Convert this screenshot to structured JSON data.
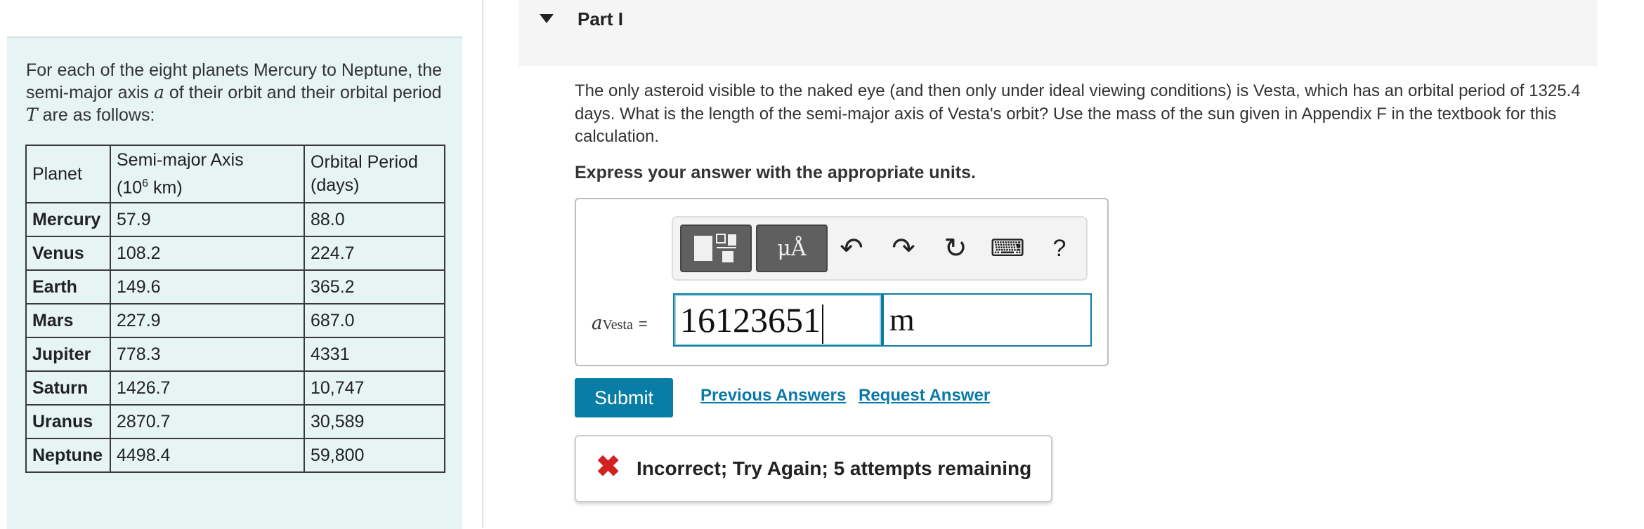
{
  "problem": {
    "intro_prefix": "For each of the eight planets Mercury to Neptune, the semi-major axis ",
    "var_a": "a",
    "intro_mid": " of their orbit and their orbital period ",
    "var_T": "T",
    "intro_suffix": " are as follows:"
  },
  "table": {
    "headers": {
      "planet": "Planet",
      "axis_line1": "Semi-major Axis",
      "axis_unit_open": "(10",
      "axis_unit_exp": "6",
      "axis_unit_close": " km)",
      "period_line1": "Orbital Period",
      "period_line2": "(days)"
    },
    "rows": [
      {
        "planet": "Mercury",
        "axis": "57.9",
        "period": "88.0"
      },
      {
        "planet": "Venus",
        "axis": "108.2",
        "period": "224.7"
      },
      {
        "planet": "Earth",
        "axis": "149.6",
        "period": "365.2"
      },
      {
        "planet": "Mars",
        "axis": "227.9",
        "period": "687.0"
      },
      {
        "planet": "Jupiter",
        "axis": "778.3",
        "period": "4331"
      },
      {
        "planet": "Saturn",
        "axis": "1426.7",
        "period": "10,747"
      },
      {
        "planet": "Uranus",
        "axis": "2870.7",
        "period": "30,589"
      },
      {
        "planet": "Neptune",
        "axis": "4498.4",
        "period": "59,800"
      }
    ]
  },
  "part": {
    "title": "Part I",
    "question": "The only asteroid visible to the naked eye (and then only under ideal viewing conditions) is Vesta, which has an orbital period of 1325.4 days. What is the length of the semi-major axis of Vesta's orbit? Use the mass of the sun given in Appendix F in the textbook for this calculation.",
    "instruction": "Express your answer with the appropriate units."
  },
  "toolbar": {
    "units_glyph": "μÅ",
    "undo_glyph": "↶",
    "redo_glyph": "↷",
    "reset_glyph": "↻",
    "keyboard_glyph": "⌨",
    "help_glyph": "?"
  },
  "answer": {
    "var_main": "a",
    "var_sub": "Vesta",
    "equals": "=",
    "value": "16123651",
    "unit": "m"
  },
  "actions": {
    "submit": "Submit",
    "previous": "Previous Answers",
    "request": "Request Answer"
  },
  "feedback": {
    "icon": "✖",
    "message": "Incorrect; Try Again; 5 attempts remaining",
    "color": "#d32020"
  }
}
